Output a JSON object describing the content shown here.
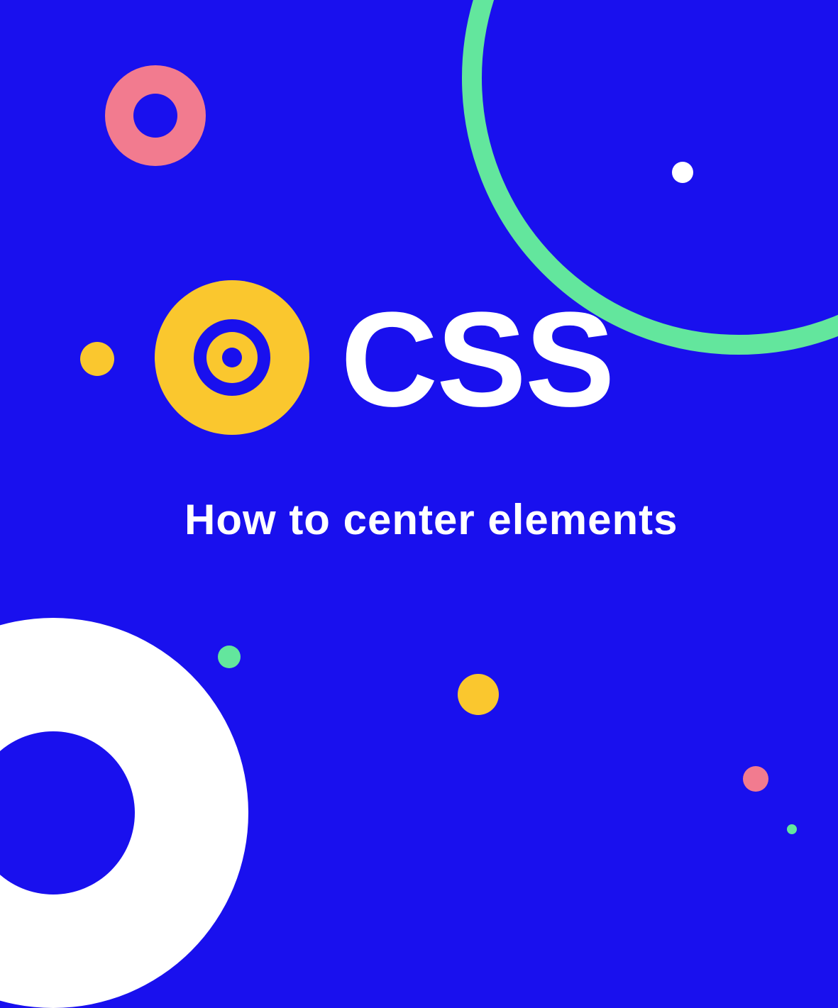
{
  "main": {
    "title": "CSS",
    "subtitle": "How to center elements"
  },
  "colors": {
    "background": "#1910ee",
    "pink": "#f27b8f",
    "yellow": "#fac72e",
    "green": "#63e69d",
    "white": "#ffffff"
  }
}
